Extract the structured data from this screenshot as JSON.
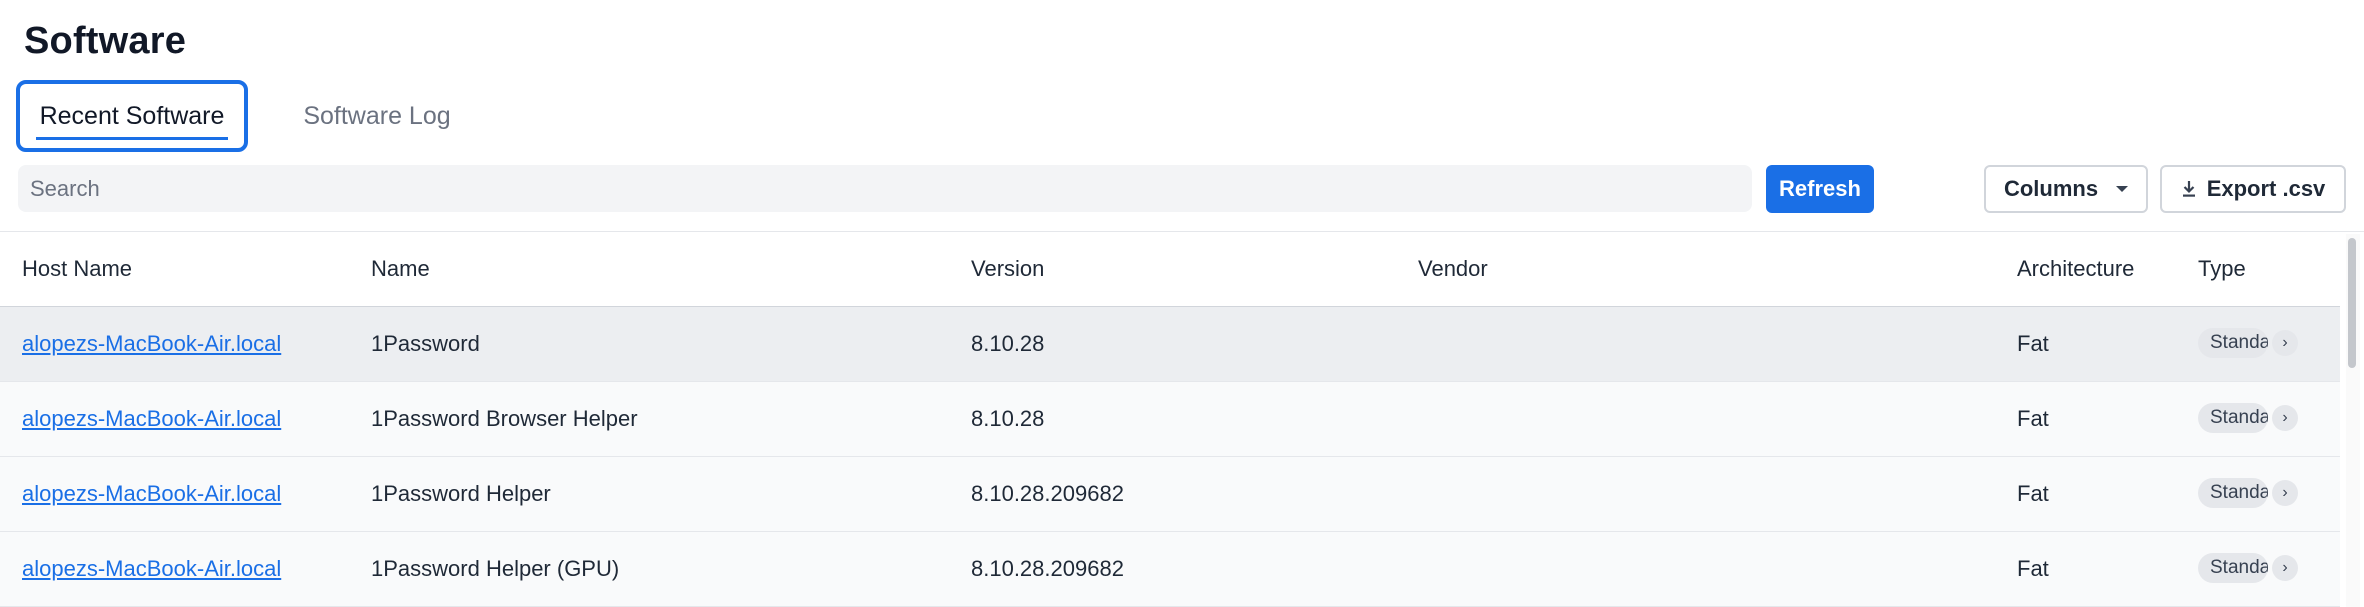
{
  "page": {
    "title": "Software"
  },
  "tabs": [
    {
      "label": "Recent Software",
      "active": true
    },
    {
      "label": "Software Log",
      "active": false
    }
  ],
  "toolbar": {
    "search_placeholder": "Search",
    "refresh_label": "Refresh",
    "columns_label": "Columns",
    "export_label": "Export .csv"
  },
  "table": {
    "columns": [
      "Host Name",
      "Name",
      "Version",
      "Vendor",
      "Architecture",
      "Type"
    ],
    "rows": [
      {
        "host": "alopezs-MacBook-Air.local",
        "name": "1Password",
        "version": "8.10.28",
        "vendor": "",
        "arch": "Fat",
        "type": "Standard"
      },
      {
        "host": "alopezs-MacBook-Air.local",
        "name": "1Password Browser Helper",
        "version": "8.10.28",
        "vendor": "",
        "arch": "Fat",
        "type": "Standard"
      },
      {
        "host": "alopezs-MacBook-Air.local",
        "name": "1Password Helper",
        "version": "8.10.28.209682",
        "vendor": "",
        "arch": "Fat",
        "type": "Standard"
      },
      {
        "host": "alopezs-MacBook-Air.local",
        "name": "1Password Helper (GPU)",
        "version": "8.10.28.209682",
        "vendor": "",
        "arch": "Fat",
        "type": "Standard"
      }
    ]
  },
  "colors": {
    "accent": "#1a6fe6",
    "link": "#1a6fe6"
  },
  "icons": {
    "columns": "caret-down-icon",
    "export": "download-icon",
    "row_expand": "chevron-right-icon"
  }
}
